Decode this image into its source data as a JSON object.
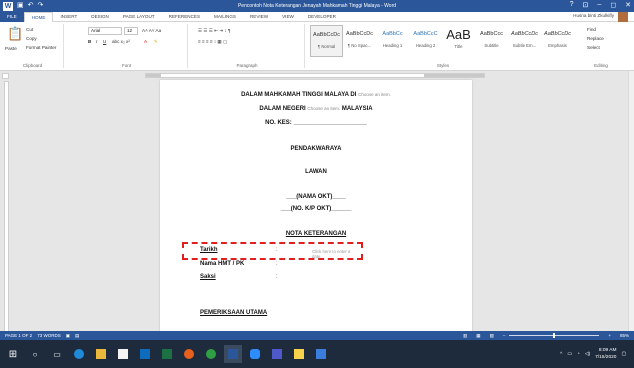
{
  "window": {
    "title": "Pencontoh Nota Keterangan Jenayah Mahkamah Tinggi Malaya - Word",
    "controls": [
      "?",
      "⊡",
      "–",
      "◻",
      "✕"
    ]
  },
  "ribbon_tabs": [
    "FILE",
    "HOME",
    "INSERT",
    "DESIGN",
    "PAGE LAYOUT",
    "REFERENCES",
    "MAILINGS",
    "REVIEW",
    "VIEW",
    "DEVELOPER"
  ],
  "user": "Husna binti Zkulkifly",
  "clipboard": {
    "paste": "Paste",
    "cut": "Cut",
    "copy": "Copy",
    "format_painter": "Format Painter",
    "label": "Clipboard"
  },
  "font": {
    "name": "Arial",
    "size": "12",
    "label": "Font"
  },
  "paragraph": {
    "label": "Paragraph"
  },
  "styles": {
    "label": "Styles",
    "items": [
      {
        "sample": "AaBbCcDc",
        "name": "¶ Normal"
      },
      {
        "sample": "AaBbCcDc",
        "name": "¶ No Spac..."
      },
      {
        "sample": "AaBbCc",
        "name": "Heading 1"
      },
      {
        "sample": "AaBbCcC",
        "name": "Heading 2"
      },
      {
        "sample": "AaB",
        "name": "Title"
      },
      {
        "sample": "AaBbCcc",
        "name": "Subtitle"
      },
      {
        "sample": "AaBbCcDc",
        "name": "Subtle Em..."
      },
      {
        "sample": "AaBbCcDc",
        "name": "Emphasis"
      }
    ]
  },
  "editing": {
    "find": "Find",
    "replace": "Replace",
    "select": "Select",
    "label": "Editing"
  },
  "document": {
    "line1": "DALAM MAHKAMAH TINGGI MALAYA DI",
    "line1_placeholder": "Choose an item.",
    "line2": "DALAM NEGERI",
    "line2_placeholder": "Choose an item.",
    "line2_suffix": "MALAYSIA",
    "case_no": "NO. KES: ______________________",
    "prosecutor": "PENDAKWARAYA",
    "versus": "LAWAN",
    "accused_name": "___(NAMA OKT)____",
    "accused_ic": "___(NO. K/P OKT)______",
    "heading": "NOTA KETERANGAN",
    "date_label": "Tarikh",
    "date_placeholder": "Click here to enter a date.",
    "judge_label": "Nama HMT / PK",
    "witness_label": "Saksi",
    "colon": ":",
    "main_exam": "PEMERIKSAAN UTAMA "
  },
  "statusbar": {
    "page": "PAGE 1 OF 2",
    "words": "73 WORDS",
    "zoom": "85%"
  },
  "taskbar": {
    "time": "8:09 AM",
    "date": "7/15/2020"
  },
  "colors": {
    "word_blue": "#2b579a",
    "annotation_red": "#e02020",
    "taskbar": "#1e2b3c"
  }
}
